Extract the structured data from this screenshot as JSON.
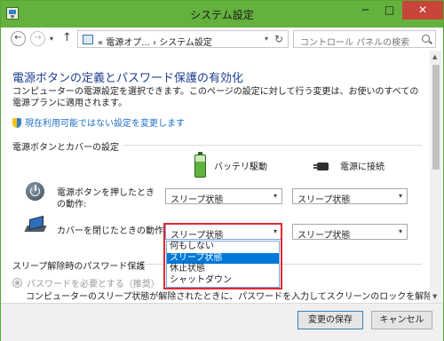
{
  "window": {
    "title": "システム設定"
  },
  "caption": {
    "minimize": "─",
    "maximize": "□",
    "close": "✕"
  },
  "nav": {
    "back": "←",
    "forward": "→",
    "history": "▾",
    "up": "↑",
    "breadcrumb": "« 電源オプ... › システム設定",
    "address_dropdown": "▾",
    "refresh": "↻",
    "search_placeholder": "コントロール パネルの検索"
  },
  "main": {
    "heading": "電源ボタンの定義とパスワード保護の有効化",
    "description": "コンピューターの電源設定を選択できます。このページの設定に対して行う変更は、お使いのすべての電源プランに適用されます。",
    "change_link": "現在利用可能ではない設定を変更します",
    "section_buttons": "電源ボタンとカバーの設定",
    "col_battery": "バッテリ駆動",
    "col_plugged": "電源に接続",
    "row_power_label": "電源ボタンを押したときの動作:",
    "row_lid_label": "カバーを閉じたときの動作:",
    "power_battery": "スリープ状態",
    "power_plugged": "スリープ状態",
    "lid_battery": "スリープ状態",
    "lid_plugged": "スリープ状態",
    "dropdown_options": [
      "何もしない",
      "スリープ状態",
      "休止状態",
      "シャットダウン"
    ],
    "dropdown_selected_index": 1,
    "section_password": "スリープ解除時のパスワード保護",
    "radio_label": "パスワードを必要とする（推奨）",
    "radio_description": "コンピューターのスリープ状態が解除されたときに、パスワードを入力してスクリーンのロックを解除しない限"
  },
  "footer": {
    "save": "変更の保存",
    "cancel": "キャンセル"
  },
  "colors": {
    "titlebar": "#64b13e",
    "close": "#c74539",
    "heading": "#1e3f91",
    "link": "#1f6fc5",
    "highlight": "#dd2a34",
    "selected": "#0078d7"
  }
}
